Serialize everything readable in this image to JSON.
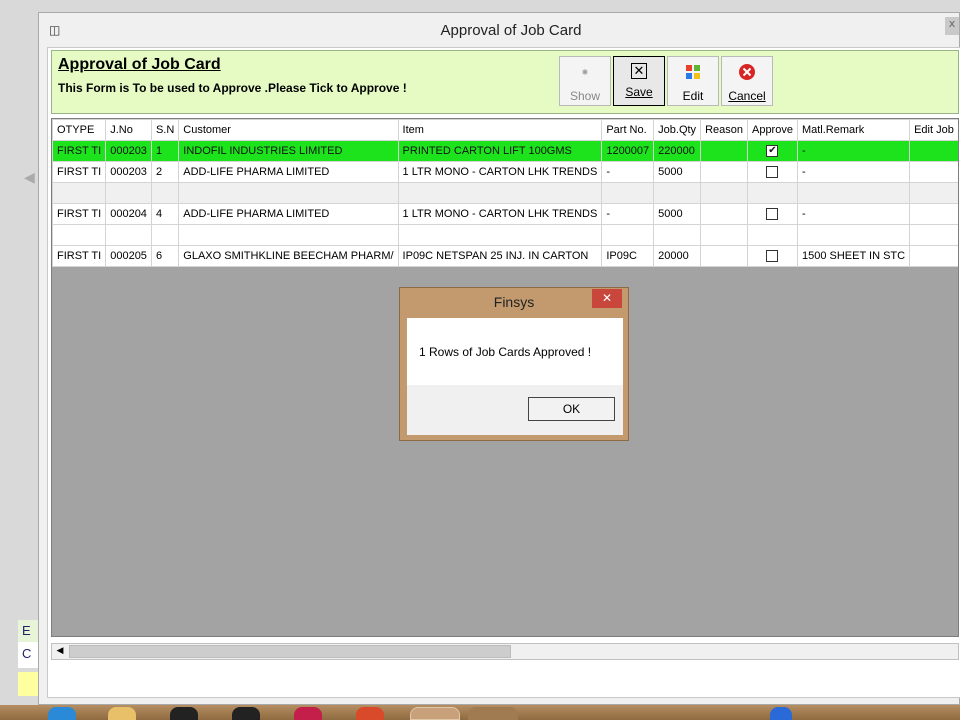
{
  "window": {
    "title": "Approval of Job Card"
  },
  "background_app": {
    "text_a": "E",
    "text_b": "C"
  },
  "header": {
    "title": "Approval of Job Card",
    "subtitle": "This Form is To be used to Approve .Please Tick to Approve !"
  },
  "toolbar": {
    "show_label": "Show",
    "save_label": "Save",
    "edit_label": "Edit",
    "cancel_label": "Cancel"
  },
  "grid": {
    "columns": [
      "OTYPE",
      "J.No",
      "S.N",
      "Customer",
      "Item",
      "Part No.",
      "Job.Qty",
      "Reason",
      "Approve",
      "Matl.Remark",
      "Edit Job"
    ],
    "rows": [
      {
        "otype": "FIRST TI",
        "jno": "000203",
        "sn": "1",
        "customer": "INDOFIL INDUSTRIES LIMITED",
        "item": "PRINTED CARTON LIFT 100GMS",
        "part": "1200007",
        "qty": "220000",
        "reason": "",
        "approve": "✔",
        "remark": "-",
        "edit": ""
      },
      {
        "otype": "FIRST TI",
        "jno": "000203",
        "sn": "2",
        "customer": "ADD-LIFE PHARMA LIMITED",
        "item": "1 LTR MONO - CARTON LHK TRENDS",
        "part": "-",
        "qty": "5000",
        "reason": "",
        "approve": "",
        "remark": "-",
        "edit": ""
      },
      {
        "otype": "FIRST TI",
        "jno": "000204",
        "sn": "4",
        "customer": "ADD-LIFE PHARMA LIMITED",
        "item": "1 LTR MONO - CARTON LHK TRENDS",
        "part": "-",
        "qty": "5000",
        "reason": "",
        "approve": "",
        "remark": "-",
        "edit": ""
      },
      {
        "otype": "FIRST TI",
        "jno": "000205",
        "sn": "6",
        "customer": "GLAXO SMITHKLINE BEECHAM PHARM/",
        "item": "IP09C NETSPAN 25 INJ. IN CARTON",
        "part": "IP09C",
        "qty": "20000",
        "reason": "",
        "approve": "",
        "remark": "1500 SHEET IN STC",
        "edit": ""
      }
    ]
  },
  "dialog": {
    "title": "Finsys",
    "message": "1 Rows of Job Cards Approved !",
    "ok_label": "OK"
  },
  "colors": {
    "header_bg": "#e6fbc4",
    "selected_row": "#1de31d",
    "grid_bg": "#a3a3a3",
    "dialog_frame": "#c29a6e",
    "dialog_close": "#c9463d"
  }
}
